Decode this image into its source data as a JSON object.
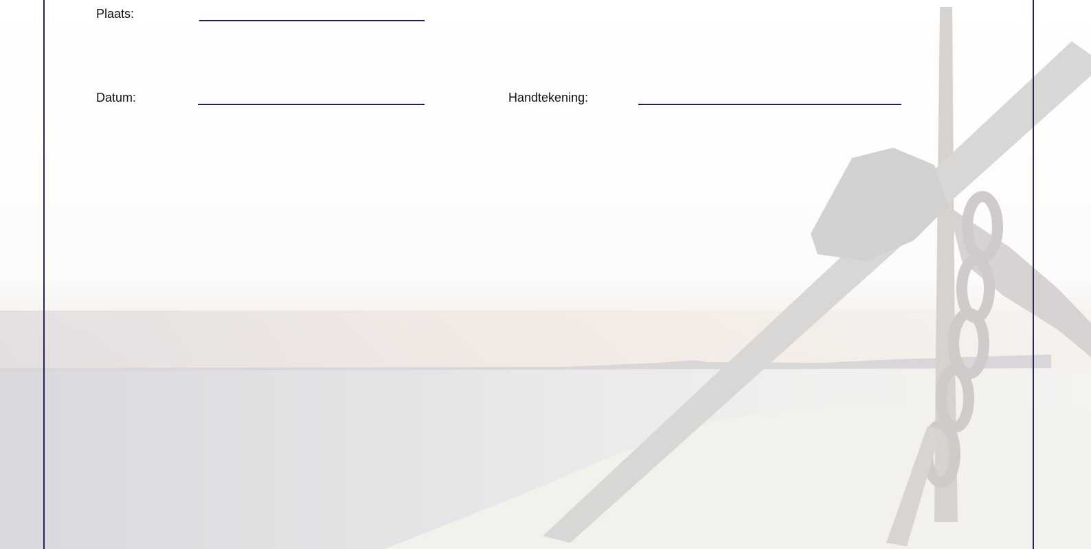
{
  "form": {
    "place_label": "Plaats:",
    "date_label": "Datum:",
    "signature_label": "Handtekening:"
  },
  "colors": {
    "frame": "#1f2660",
    "line": "#1a2157",
    "text": "#111111"
  },
  "background": {
    "icon": "anchor-and-chain-at-shore-watermark"
  }
}
